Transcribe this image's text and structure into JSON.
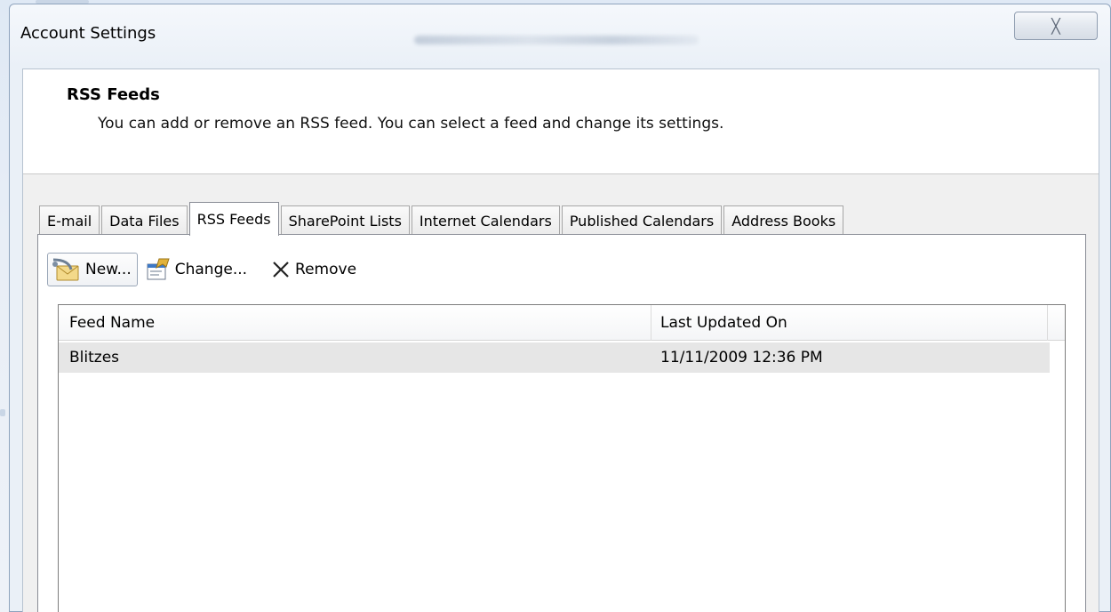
{
  "window": {
    "title": "Account Settings",
    "close_glyph": "╳"
  },
  "header": {
    "title": "RSS Feeds",
    "description": "You can add or remove an RSS feed. You can select a feed and change its settings."
  },
  "tabs": [
    {
      "label": "E-mail",
      "active": false
    },
    {
      "label": "Data Files",
      "active": false
    },
    {
      "label": "RSS Feeds",
      "active": true
    },
    {
      "label": "SharePoint Lists",
      "active": false
    },
    {
      "label": "Internet Calendars",
      "active": false
    },
    {
      "label": "Published Calendars",
      "active": false
    },
    {
      "label": "Address Books",
      "active": false
    }
  ],
  "toolbar": {
    "new_label": "New...",
    "change_label": "Change...",
    "remove_label": "Remove",
    "new_icon": "new-feed-icon",
    "change_icon": "change-settings-icon",
    "remove_icon": "remove-x-icon"
  },
  "feeds": {
    "columns": [
      "Feed Name",
      "Last Updated On"
    ],
    "rows": [
      {
        "name": "Blitzes",
        "last_updated": "11/11/2009 12:36 PM",
        "selected": true
      }
    ]
  },
  "colors": {
    "selected_row": "#e6e6e6",
    "dialog_frame": "#eaf0f7",
    "panel": "#f0f0f0"
  }
}
